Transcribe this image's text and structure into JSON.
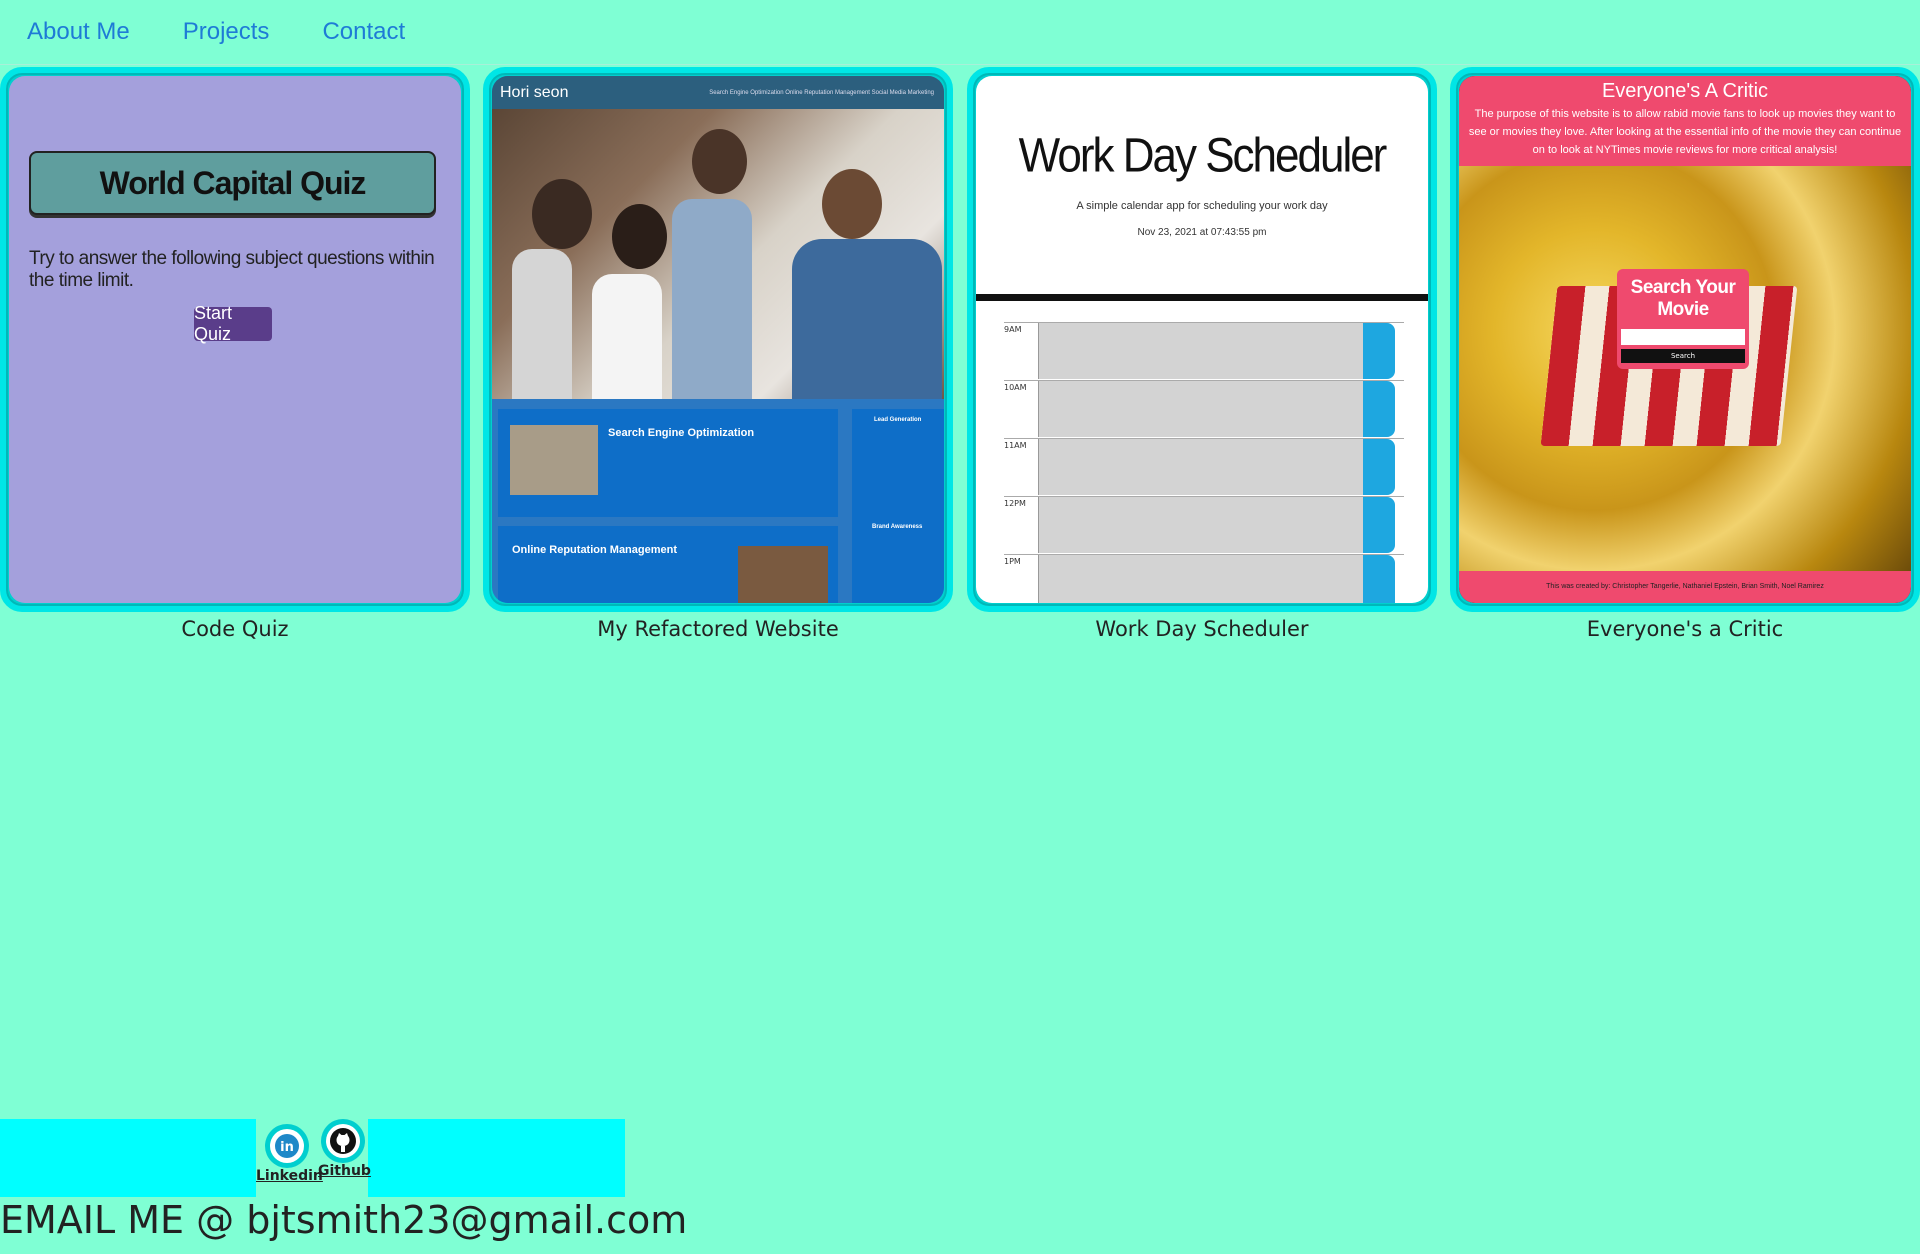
{
  "nav": {
    "items": [
      {
        "label": "About Me"
      },
      {
        "label": "Projects"
      },
      {
        "label": "Contact"
      }
    ]
  },
  "cards": [
    {
      "caption": "Code Quiz",
      "preview": {
        "title": "World Capital Quiz",
        "text": "Try to answer the following subject questions within the time limit.",
        "button": "Start Quiz"
      }
    },
    {
      "caption": "My Refactored Website",
      "preview": {
        "brand": "Hori seon",
        "nav": "Search Engine Optimization   Online Reputation Management   Social Media Marketing",
        "section1": "Search Engine Optimization",
        "section2": "Online Reputation Management",
        "side1": "Lead Generation",
        "side2": "Brand Awareness"
      }
    },
    {
      "caption": "Work Day Scheduler",
      "preview": {
        "title": "Work Day Scheduler",
        "subtitle": "A simple calendar app for scheduling your work day",
        "date": "Nov 23, 2021 at 07:43:55 pm",
        "hours": [
          "9AM",
          "10AM",
          "11AM",
          "12PM",
          "1PM"
        ]
      }
    },
    {
      "caption": "Everyone's a Critic",
      "preview": {
        "title": "Everyone's A Critic",
        "text": "The purpose of this website is to allow rabid movie fans to look up movies they want to see or movies they love. After looking at the essential info of the movie they can continue on to look at NYTimes movie reviews for more critical analysis!",
        "search_label": "Search Your Movie",
        "search_button": "Search",
        "footer": "This was created by: Christopher Tangerlie, Nathaniel Epstein, Brian Smith, Noel Ramirez"
      }
    }
  ],
  "footer": {
    "linkedin_label": "Linkedin",
    "github_label": "Github",
    "email": "EMAIL ME @ bjtsmith23@gmail.com"
  },
  "colors": {
    "background": "#7fffd4",
    "accent": "#00ffff",
    "link": "#1e7bd6"
  }
}
